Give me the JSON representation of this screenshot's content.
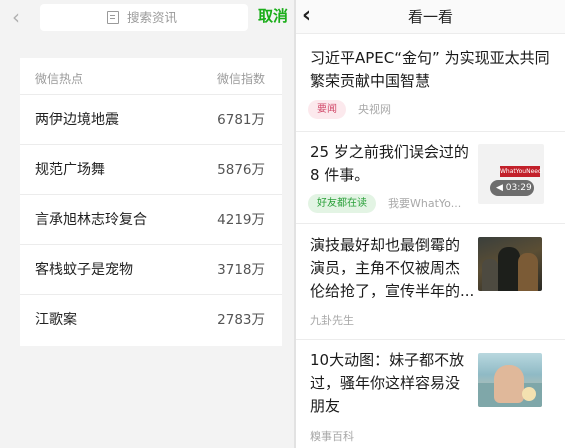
{
  "left": {
    "back_glyph": "‹",
    "search": {
      "placeholder": "搜索资讯"
    },
    "cancel_label": "取消",
    "hot": {
      "col_topic": "微信热点",
      "col_index": "微信指数",
      "rows": [
        {
          "title": "两伊边境地震",
          "value": "6781万"
        },
        {
          "title": "规范广场舞",
          "value": "5876万"
        },
        {
          "title": "言承旭林志玲复合",
          "value": "4219万"
        },
        {
          "title": "客栈蚊子是宠物",
          "value": "3718万"
        },
        {
          "title": "江歌案",
          "value": "2783万"
        }
      ]
    }
  },
  "right": {
    "back_glyph": "‹",
    "title": "看一看",
    "articles": [
      {
        "title_lines": [
          "习近平APEC“金句” 为实现亚太共同",
          "繁荣贡献中国智慧"
        ],
        "tag": "要闻",
        "source": "央视网"
      },
      {
        "title_lines": [
          "25 岁之前我们误会过的",
          "8 件事。"
        ],
        "tag": "好友都在读",
        "source": "我要WhatYo...",
        "thumb_logo": "WhatYouNeed",
        "duration": "03:29"
      },
      {
        "title_lines": [
          "演技最好却也最倒霉的",
          "演员，主角不仅被周杰",
          "伦给抢了，宣传半年的..."
        ],
        "source": "九卦先生"
      },
      {
        "title_lines": [
          "10大动图：妹子都不放",
          "过，骚年你这样容易没",
          "朋友"
        ],
        "source": "糗事百科"
      }
    ]
  },
  "colors": {
    "accent_green": "#1aad19",
    "tag_news_text": "#d14a6a",
    "tag_friends_text": "#2aa03a"
  }
}
